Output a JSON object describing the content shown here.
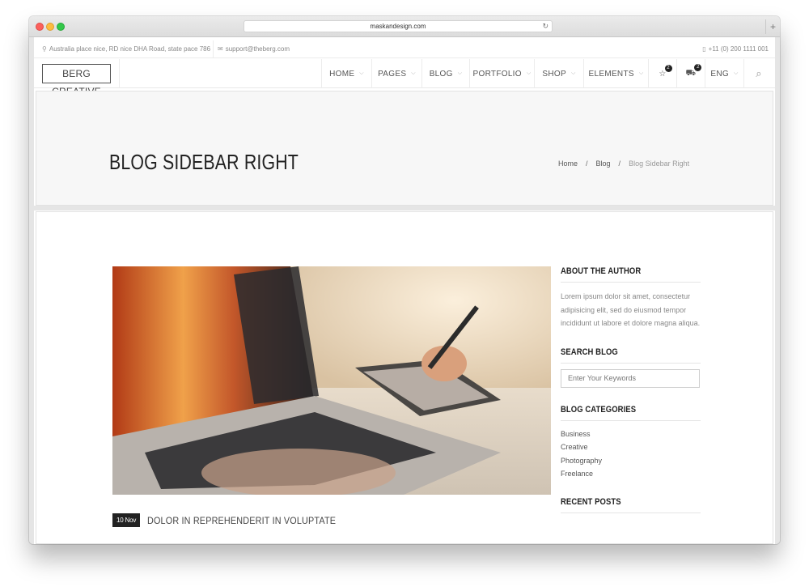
{
  "browser": {
    "url": "maskandesign.com",
    "reload_glyph": "↻",
    "newtab_glyph": "+"
  },
  "topbar": {
    "address": "Australia place nice, RD nice DHA Road, state pace 786",
    "email": "support@theberg.com",
    "phone": "+11 (0) 200 1111 001",
    "pin_icon": "⚲",
    "mail_icon": "✉",
    "phone_icon": "▯"
  },
  "nav": {
    "logo": "BERG CREATIVE",
    "menu": [
      {
        "label": "HOME",
        "chevron": "⌵"
      },
      {
        "label": "PAGES",
        "chevron": "⌵"
      },
      {
        "label": "BLOG",
        "chevron": "⌵"
      },
      {
        "label": "PORTFOLIO",
        "chevron": "⌵"
      },
      {
        "label": "SHOP",
        "chevron": "⌵"
      },
      {
        "label": "ELEMENTS",
        "chevron": "⌵"
      }
    ],
    "wishlist_icon": "☆",
    "wishlist_count": "2",
    "cart_icon": "⛟",
    "cart_count": "2",
    "language": "ENG",
    "language_chevron": "⌵",
    "search_icon": "⌕"
  },
  "title_band": {
    "title": "BLOG SIDEBAR RIGHT",
    "breadcrumb": {
      "home": "Home",
      "blog": "Blog",
      "current": "Blog Sidebar Right",
      "separator": "/"
    }
  },
  "post": {
    "date": "10 Nov",
    "title": "DOLOR IN REPREHENDERIT IN VOLUPTATE"
  },
  "sidebar": {
    "about_title": "ABOUT THE AUTHOR",
    "about_text": "Lorem ipsum dolor sit amet, consectetur adipisicing elit, sed do eiusmod tempor incididunt ut labore et dolore magna aliqua.",
    "search_title": "SEARCH BLOG",
    "search_placeholder": "Enter Your Keywords",
    "categories_title": "BLOG CATEGORIES",
    "categories": [
      "Business",
      "Creative",
      "Photography",
      "Freelance"
    ],
    "recent_title": "RECENT POSTS"
  }
}
